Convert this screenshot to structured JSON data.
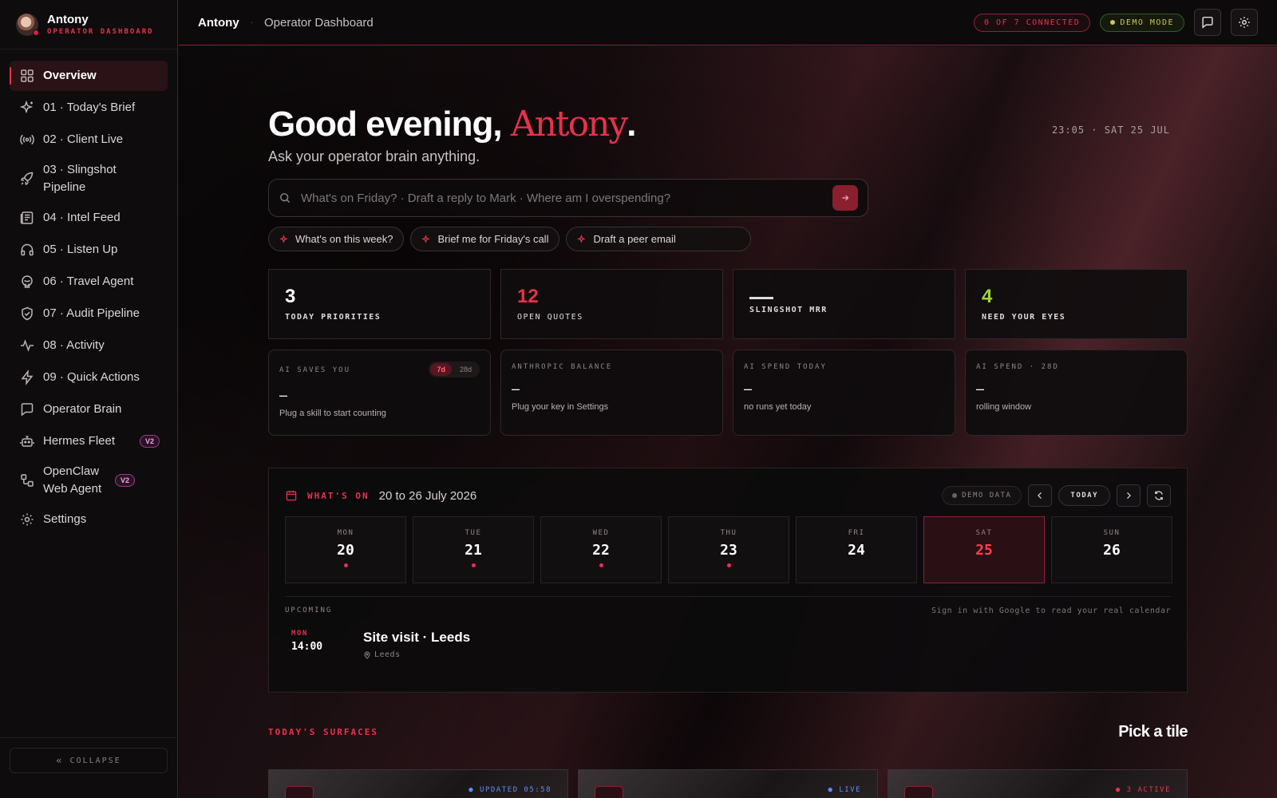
{
  "sidebar": {
    "user_name": "Antony",
    "user_subtitle": "OPERATOR DASHBOARD",
    "items": [
      {
        "label": "Overview",
        "icon": "grid-icon"
      },
      {
        "label": "01 · Today's Brief",
        "icon": "sparkle-icon"
      },
      {
        "label": "02 · Client Live",
        "icon": "broadcast-icon"
      },
      {
        "label": "03 · Slingshot Pipeline",
        "icon": "rocket-icon"
      },
      {
        "label": "04 · Intel Feed",
        "icon": "newspaper-icon"
      },
      {
        "label": "05 · Listen Up",
        "icon": "headphones-icon"
      },
      {
        "label": "06 · Travel Agent",
        "icon": "globe-icon"
      },
      {
        "label": "07 · Audit Pipeline",
        "icon": "shield-icon"
      },
      {
        "label": "08 · Activity",
        "icon": "pulse-icon"
      },
      {
        "label": "09 · Quick Actions",
        "icon": "bolt-icon"
      },
      {
        "label": "Operator Brain",
        "icon": "chat-icon"
      },
      {
        "label": "Hermes Fleet",
        "icon": "bot-icon",
        "badge": "V2"
      },
      {
        "label": "OpenClaw Web Agent",
        "icon": "workflow-icon",
        "badge": "V2"
      },
      {
        "label": "Settings",
        "icon": "gear-icon"
      }
    ],
    "collapse_label": "COLLAPSE"
  },
  "header": {
    "name": "Antony",
    "separator": "·",
    "title": "Operator Dashboard",
    "connected": "0 OF 7 CONNECTED",
    "demo_mode": "DEMO MODE"
  },
  "hero": {
    "greeting": "Good evening,",
    "name": "Antony",
    "period": ".",
    "subtitle": "Ask your operator brain anything.",
    "clock": "23:05 · SAT 25 JUL",
    "search_placeholder": "What's on Friday? · Draft a reply to Mark · Where am I overspending?",
    "chips": [
      "What's on this week?",
      "Brief me for Friday's call",
      "Draft a peer email"
    ]
  },
  "stats": [
    {
      "value": "3",
      "label": "TODAY PRIORITIES"
    },
    {
      "value": "12",
      "label": "OPEN QUOTES"
    },
    {
      "value": "",
      "label": "SLINGSHOT MRR"
    },
    {
      "value": "4",
      "label": "NEED YOUR EYES"
    }
  ],
  "cards": [
    {
      "title": "AI SAVES YOU",
      "value": "–",
      "sub": "Plug a skill to start counting",
      "toggle": [
        "7d",
        "28d"
      ]
    },
    {
      "title": "ANTHROPIC BALANCE",
      "value": "–",
      "sub": "Plug your key in Settings"
    },
    {
      "title": "AI SPEND TODAY",
      "value": "–",
      "sub": "no runs yet today"
    },
    {
      "title": "AI SPEND · 28D",
      "value": "–",
      "sub": "rolling window"
    }
  ],
  "calendar": {
    "title": "WHAT'S ON",
    "range": "20 to 26 July 2026",
    "demo_data": "DEMO DATA",
    "today": "TODAY",
    "days": [
      {
        "dow": "MON",
        "num": "20",
        "has_event": true
      },
      {
        "dow": "TUE",
        "num": "21",
        "has_event": true
      },
      {
        "dow": "WED",
        "num": "22",
        "has_event": true
      },
      {
        "dow": "THU",
        "num": "23",
        "has_event": true
      },
      {
        "dow": "FRI",
        "num": "24",
        "has_event": false
      },
      {
        "dow": "SAT",
        "num": "25",
        "has_event": false,
        "selected": true
      },
      {
        "dow": "SUN",
        "num": "26",
        "has_event": false
      }
    ],
    "upcoming_label": "UPCOMING",
    "google_hint": "Sign in with Google to read your real calendar",
    "event": {
      "day": "MON",
      "time": "14:00",
      "title": "Site visit · Leeds",
      "location": "Leeds"
    }
  },
  "surfaces": {
    "label": "TODAY'S SURFACES",
    "pick": "Pick a tile",
    "tiles": [
      {
        "status": "● UPDATED 05:58",
        "status_color": "#5b8cff"
      },
      {
        "status": "● LIVE",
        "status_color": "#5b8cff"
      },
      {
        "status": "● 3 ACTIVE",
        "status_color": "#e8324a"
      }
    ]
  },
  "colors": {
    "accent": "#e8324a",
    "green": "#9bd43a",
    "demo": "#d4c25a"
  }
}
